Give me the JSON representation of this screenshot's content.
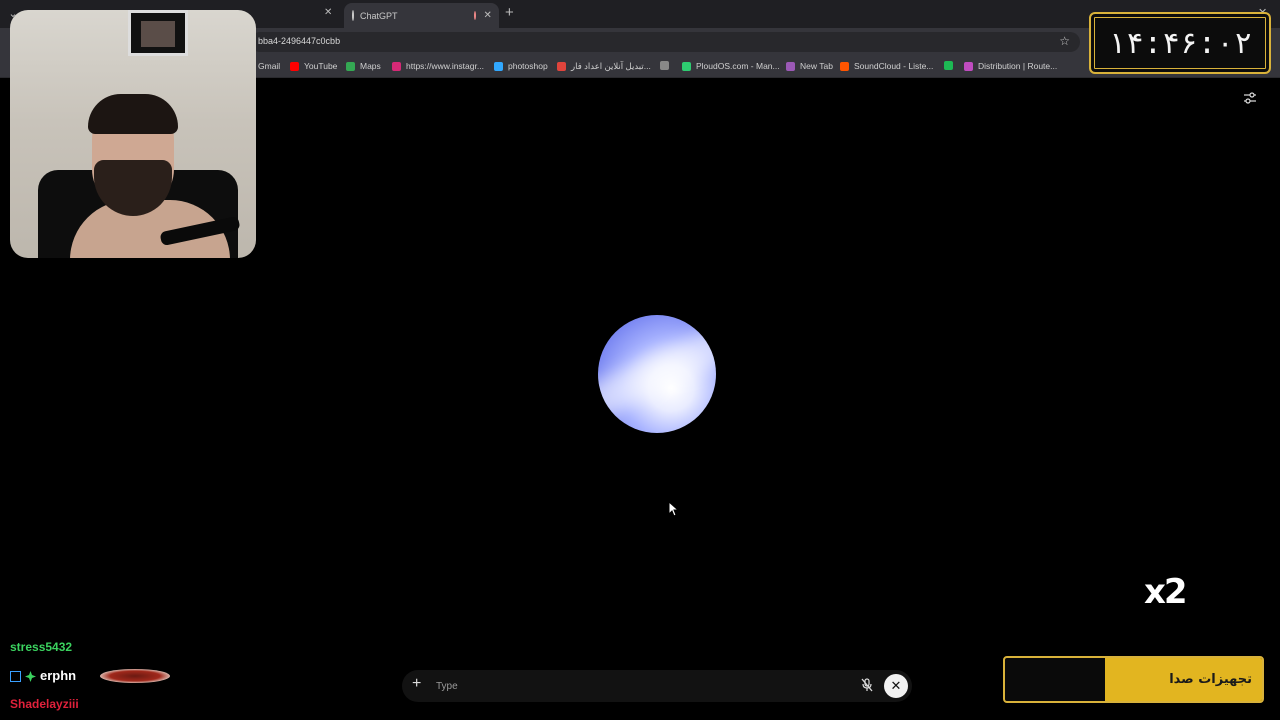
{
  "browser": {
    "active_tab_title": "ChatGPT",
    "url": "bba4-2496447c0cbb",
    "bookmarks": [
      {
        "label": "Gmail",
        "color": "#ea4335"
      },
      {
        "label": "YouTube",
        "color": "#ff0000"
      },
      {
        "label": "Maps",
        "color": "#34a853"
      },
      {
        "label": "https://www.instagr...",
        "color": "#d62976"
      },
      {
        "label": "photoshop",
        "color": "#31a8ff"
      },
      {
        "label": "تبدیل آنلاین اعداد فار...",
        "color": "#e0443c"
      },
      {
        "label": "",
        "color": "#888888"
      },
      {
        "label": "PloudOS.com - Man...",
        "color": "#2ecc71"
      },
      {
        "label": "New Tab",
        "color": "#9b59b6"
      },
      {
        "label": "SoundCloud - Liste...",
        "color": "#ff5500"
      },
      {
        "label": "",
        "color": "#1db954"
      },
      {
        "label": "Distribution | Route...",
        "color": "#c04cc0"
      }
    ]
  },
  "composer": {
    "placeholder": "Type"
  },
  "overlay": {
    "clock": "۱۴:۴۶:۰۲",
    "speed": "x2",
    "gear_label": "تجهیزات صدا",
    "chat": [
      {
        "user": "stress5432",
        "color": "#3bd25f"
      },
      {
        "user": "erphn",
        "color": "#ffffff"
      },
      {
        "user": "Shadelayziii",
        "color": "#e0213b"
      }
    ]
  },
  "colors": {
    "accent_gold": "#d9b23a",
    "orb_blue": "#7b88f2"
  }
}
